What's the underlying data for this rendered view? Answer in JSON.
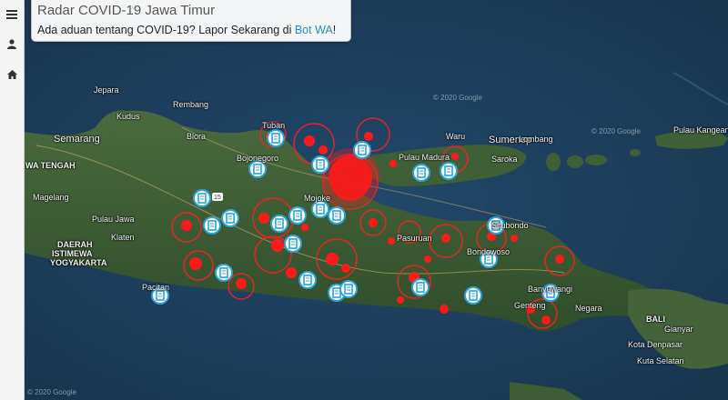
{
  "info_panel": {
    "title": "Radar COVID-19 Jawa Timur",
    "subtitle_prefix": "Ada aduan tentang COVID-19? Lapor Sekarang di ",
    "link_text": "Bot WA",
    "subtitle_suffix": "!"
  },
  "sidebar": {
    "items": [
      {
        "icon": "menu-icon"
      },
      {
        "icon": "user-icon"
      },
      {
        "icon": "home-icon"
      }
    ]
  },
  "map": {
    "watermarks": [
      "© 2020 Google",
      "© 2020 Google",
      "© 2020 Google"
    ],
    "places": {
      "jepara": "Jepara",
      "kudus": "Kudus",
      "rembang": "Rembang",
      "semarang": "Semarang",
      "blora": "Blora",
      "tuban": "Tuban",
      "bojonegoro": "Bojonegoro",
      "jawa_tengah": "WA TENGAH",
      "magelang": "Magelang",
      "pulau_jawa": "Pulau Jawa",
      "daerah": "DAERAH",
      "istimewa": "ISTIMEWA",
      "yogyakarta": "YOGYAKARTA",
      "klaten": "Klaten",
      "pacitan": "Pacitan",
      "waru": "Waru",
      "pulau_madura": "Pulau Madura",
      "sumenep": "Sumenep",
      "saroka": "Saroka",
      "lombang": "Lombang",
      "pulau_kangean": "Pulau Kangean",
      "mojoke": "Mojoke",
      "situbondo": "Situbondo",
      "bondowoso": "Bondowoso",
      "banyuwangi": "Banyuwangi",
      "genteng": "Genteng",
      "negara": "Negara",
      "bali": "BALI",
      "gianyar": "Gianyar",
      "kota_denpasar": "Kota Denpasar",
      "kuta_selatan": "Kuta Selatan",
      "pasuruan": "Pasuruan"
    },
    "road_shield": "15"
  },
  "colors": {
    "sea": "#1c3a52",
    "land": "#3d5a34",
    "marker_red": "#ff1a1a",
    "facility_blue": "#2aa3d8"
  }
}
